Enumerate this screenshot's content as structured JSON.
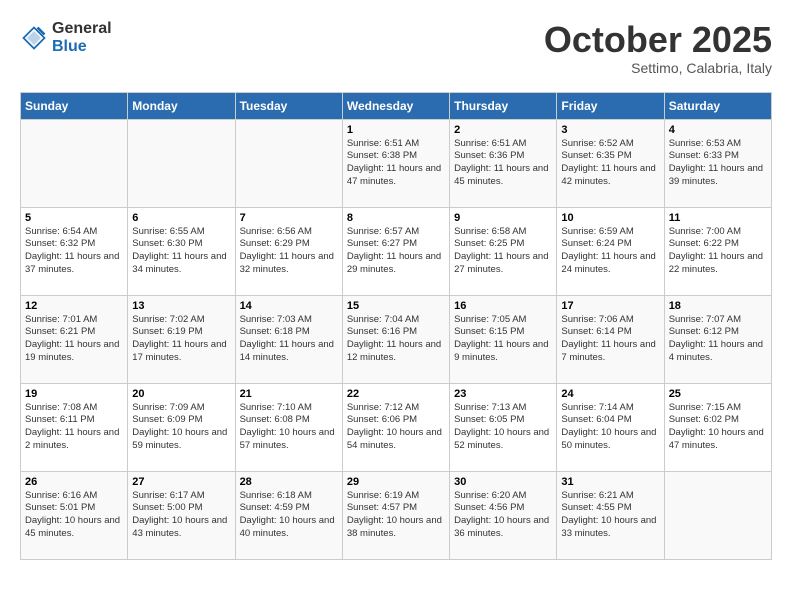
{
  "header": {
    "logo_general": "General",
    "logo_blue": "Blue",
    "month_title": "October 2025",
    "location": "Settimo, Calabria, Italy"
  },
  "days_of_week": [
    "Sunday",
    "Monday",
    "Tuesday",
    "Wednesday",
    "Thursday",
    "Friday",
    "Saturday"
  ],
  "weeks": [
    [
      {
        "day": "",
        "info": ""
      },
      {
        "day": "",
        "info": ""
      },
      {
        "day": "",
        "info": ""
      },
      {
        "day": "1",
        "info": "Sunrise: 6:51 AM\nSunset: 6:38 PM\nDaylight: 11 hours and 47 minutes."
      },
      {
        "day": "2",
        "info": "Sunrise: 6:51 AM\nSunset: 6:36 PM\nDaylight: 11 hours and 45 minutes."
      },
      {
        "day": "3",
        "info": "Sunrise: 6:52 AM\nSunset: 6:35 PM\nDaylight: 11 hours and 42 minutes."
      },
      {
        "day": "4",
        "info": "Sunrise: 6:53 AM\nSunset: 6:33 PM\nDaylight: 11 hours and 39 minutes."
      }
    ],
    [
      {
        "day": "5",
        "info": "Sunrise: 6:54 AM\nSunset: 6:32 PM\nDaylight: 11 hours and 37 minutes."
      },
      {
        "day": "6",
        "info": "Sunrise: 6:55 AM\nSunset: 6:30 PM\nDaylight: 11 hours and 34 minutes."
      },
      {
        "day": "7",
        "info": "Sunrise: 6:56 AM\nSunset: 6:29 PM\nDaylight: 11 hours and 32 minutes."
      },
      {
        "day": "8",
        "info": "Sunrise: 6:57 AM\nSunset: 6:27 PM\nDaylight: 11 hours and 29 minutes."
      },
      {
        "day": "9",
        "info": "Sunrise: 6:58 AM\nSunset: 6:25 PM\nDaylight: 11 hours and 27 minutes."
      },
      {
        "day": "10",
        "info": "Sunrise: 6:59 AM\nSunset: 6:24 PM\nDaylight: 11 hours and 24 minutes."
      },
      {
        "day": "11",
        "info": "Sunrise: 7:00 AM\nSunset: 6:22 PM\nDaylight: 11 hours and 22 minutes."
      }
    ],
    [
      {
        "day": "12",
        "info": "Sunrise: 7:01 AM\nSunset: 6:21 PM\nDaylight: 11 hours and 19 minutes."
      },
      {
        "day": "13",
        "info": "Sunrise: 7:02 AM\nSunset: 6:19 PM\nDaylight: 11 hours and 17 minutes."
      },
      {
        "day": "14",
        "info": "Sunrise: 7:03 AM\nSunset: 6:18 PM\nDaylight: 11 hours and 14 minutes."
      },
      {
        "day": "15",
        "info": "Sunrise: 7:04 AM\nSunset: 6:16 PM\nDaylight: 11 hours and 12 minutes."
      },
      {
        "day": "16",
        "info": "Sunrise: 7:05 AM\nSunset: 6:15 PM\nDaylight: 11 hours and 9 minutes."
      },
      {
        "day": "17",
        "info": "Sunrise: 7:06 AM\nSunset: 6:14 PM\nDaylight: 11 hours and 7 minutes."
      },
      {
        "day": "18",
        "info": "Sunrise: 7:07 AM\nSunset: 6:12 PM\nDaylight: 11 hours and 4 minutes."
      }
    ],
    [
      {
        "day": "19",
        "info": "Sunrise: 7:08 AM\nSunset: 6:11 PM\nDaylight: 11 hours and 2 minutes."
      },
      {
        "day": "20",
        "info": "Sunrise: 7:09 AM\nSunset: 6:09 PM\nDaylight: 10 hours and 59 minutes."
      },
      {
        "day": "21",
        "info": "Sunrise: 7:10 AM\nSunset: 6:08 PM\nDaylight: 10 hours and 57 minutes."
      },
      {
        "day": "22",
        "info": "Sunrise: 7:12 AM\nSunset: 6:06 PM\nDaylight: 10 hours and 54 minutes."
      },
      {
        "day": "23",
        "info": "Sunrise: 7:13 AM\nSunset: 6:05 PM\nDaylight: 10 hours and 52 minutes."
      },
      {
        "day": "24",
        "info": "Sunrise: 7:14 AM\nSunset: 6:04 PM\nDaylight: 10 hours and 50 minutes."
      },
      {
        "day": "25",
        "info": "Sunrise: 7:15 AM\nSunset: 6:02 PM\nDaylight: 10 hours and 47 minutes."
      }
    ],
    [
      {
        "day": "26",
        "info": "Sunrise: 6:16 AM\nSunset: 5:01 PM\nDaylight: 10 hours and 45 minutes."
      },
      {
        "day": "27",
        "info": "Sunrise: 6:17 AM\nSunset: 5:00 PM\nDaylight: 10 hours and 43 minutes."
      },
      {
        "day": "28",
        "info": "Sunrise: 6:18 AM\nSunset: 4:59 PM\nDaylight: 10 hours and 40 minutes."
      },
      {
        "day": "29",
        "info": "Sunrise: 6:19 AM\nSunset: 4:57 PM\nDaylight: 10 hours and 38 minutes."
      },
      {
        "day": "30",
        "info": "Sunrise: 6:20 AM\nSunset: 4:56 PM\nDaylight: 10 hours and 36 minutes."
      },
      {
        "day": "31",
        "info": "Sunrise: 6:21 AM\nSunset: 4:55 PM\nDaylight: 10 hours and 33 minutes."
      },
      {
        "day": "",
        "info": ""
      }
    ]
  ]
}
